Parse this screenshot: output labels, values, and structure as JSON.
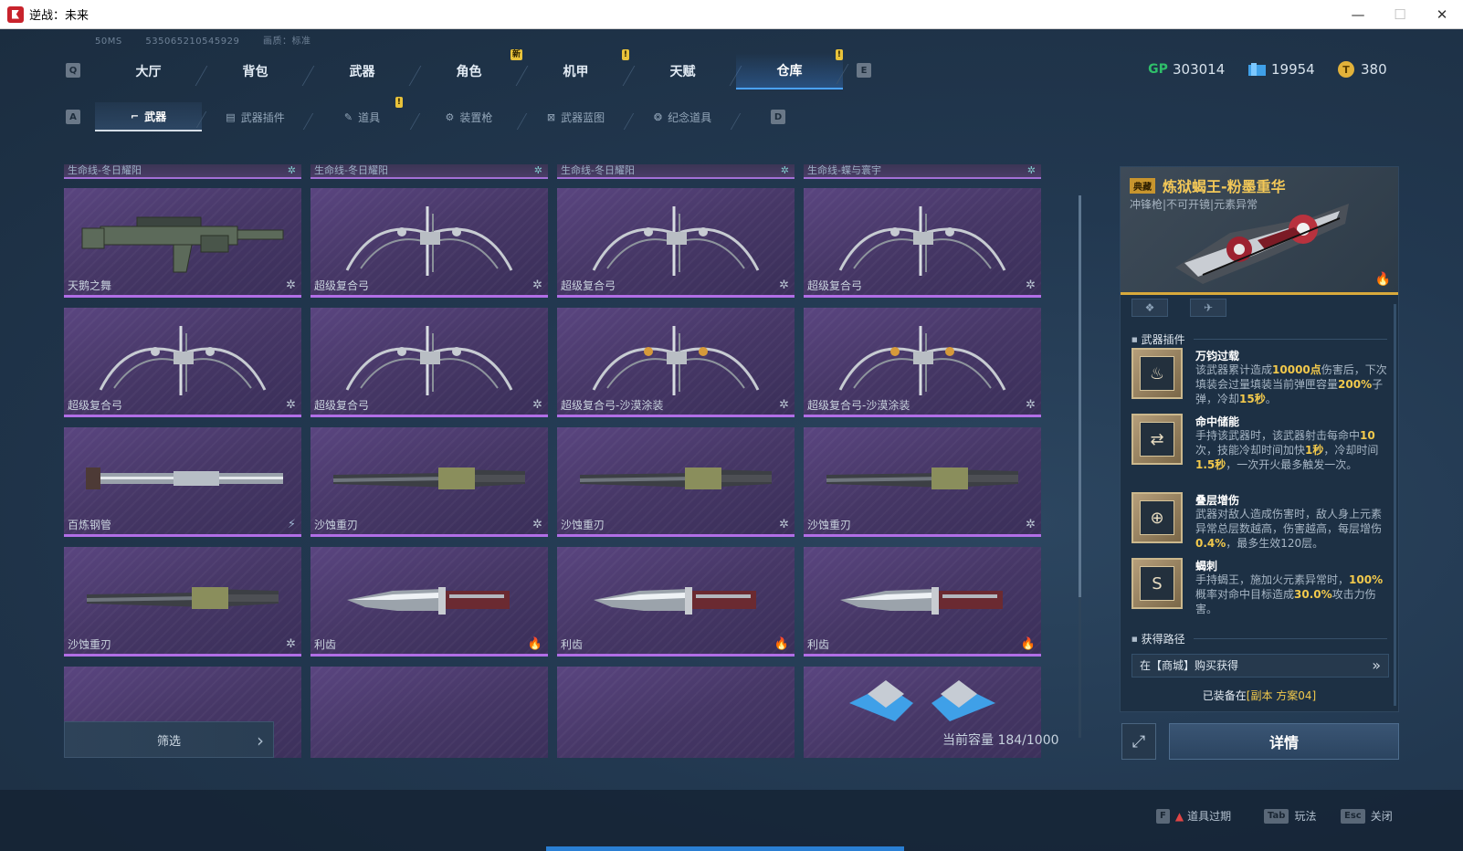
{
  "window": {
    "title": "逆战：未来",
    "controls": [
      "—",
      "☐",
      "✕"
    ]
  },
  "netinfo": {
    "ping": "50MS",
    "id": "535065210545929",
    "quality": "画质：标准"
  },
  "keys": {
    "q": "Q",
    "e": "E",
    "a": "A",
    "d": "D"
  },
  "main_tabs": [
    {
      "label": "大厅",
      "badge": ""
    },
    {
      "label": "背包",
      "badge": ""
    },
    {
      "label": "武器",
      "badge": ""
    },
    {
      "label": "角色",
      "badge": "新"
    },
    {
      "label": "机甲",
      "badge": "!"
    },
    {
      "label": "天赋",
      "badge": ""
    },
    {
      "label": "仓库",
      "badge": "!"
    }
  ],
  "active_main_tab": "仓库",
  "currency": {
    "gp": "303014",
    "ticket": "19954",
    "coin": "380",
    "gp_label": "GP"
  },
  "sub_tabs": [
    {
      "label": "武器",
      "icon": "gun-icon",
      "badge": ""
    },
    {
      "label": "武器插件",
      "icon": "plugin-icon",
      "badge": ""
    },
    {
      "label": "道具",
      "icon": "item-icon",
      "badge": "!"
    },
    {
      "label": "装置枪",
      "icon": "device-gun-icon",
      "badge": ""
    },
    {
      "label": "武器蓝图",
      "icon": "blueprint-icon",
      "badge": ""
    },
    {
      "label": "纪念道具",
      "icon": "souvenir-icon",
      "badge": ""
    }
  ],
  "header_cards": [
    "生命线-冬日耀阳",
    "生命线-冬日耀阳",
    "生命线-冬日耀阳",
    "生命线-蝶与寰宇"
  ],
  "cards": [
    {
      "name": "天鹅之舞",
      "type": "rifle",
      "mark": "✲"
    },
    {
      "name": "超级复合弓",
      "type": "bow",
      "mark": "✲"
    },
    {
      "name": "超级复合弓",
      "type": "bow",
      "mark": "✲"
    },
    {
      "name": "超级复合弓",
      "type": "bow",
      "mark": "✲"
    },
    {
      "name": "超级复合弓",
      "type": "bow",
      "mark": "✲"
    },
    {
      "name": "超级复合弓",
      "type": "bow",
      "mark": "✲"
    },
    {
      "name": "超级复合弓-沙漠涂装",
      "type": "bow-gold",
      "mark": "✲"
    },
    {
      "name": "超级复合弓-沙漠涂装",
      "type": "bow-gold",
      "mark": "✲"
    },
    {
      "name": "百炼钢管",
      "type": "pipe",
      "mark": "⚡"
    },
    {
      "name": "沙蚀重刃",
      "type": "blade",
      "mark": "✲"
    },
    {
      "name": "沙蚀重刃",
      "type": "blade",
      "mark": "✲"
    },
    {
      "name": "沙蚀重刃",
      "type": "blade",
      "mark": "✲"
    },
    {
      "name": "沙蚀重刃",
      "type": "blade",
      "mark": "✲"
    },
    {
      "name": "利齿",
      "type": "knife",
      "mark": "🔥"
    },
    {
      "name": "利齿",
      "type": "knife",
      "mark": "🔥"
    },
    {
      "name": "利齿",
      "type": "knife",
      "mark": "🔥"
    },
    {
      "name": "",
      "type": "partial",
      "mark": ""
    },
    {
      "name": "",
      "type": "partial",
      "mark": ""
    },
    {
      "name": "",
      "type": "partial",
      "mark": ""
    },
    {
      "name": "",
      "type": "partial-wings",
      "mark": ""
    }
  ],
  "filter": {
    "label": "筛选"
  },
  "capacity": "当前容量 184/1000",
  "detail": {
    "rarity": "典藏",
    "name": "炼狱蝎王-粉墨重华",
    "subtitle": "冲锋枪|不可开镜|元素异常",
    "plugins_title": "武器插件",
    "plugins": [
      {
        "name": "万钧过载",
        "icon": "♨",
        "desc_parts": [
          {
            "t": "该武器累计造成",
            "h": false
          },
          {
            "t": "10000点",
            "h": true
          },
          {
            "t": "伤害后，下次填装会过量填装当前弹匣容量",
            "h": false
          },
          {
            "t": "200%",
            "h": true
          },
          {
            "t": "子弹，冷却",
            "h": false
          },
          {
            "t": "15秒",
            "h": true
          },
          {
            "t": "。",
            "h": false
          }
        ]
      },
      {
        "name": "命中储能",
        "icon": "⇄",
        "desc_parts": [
          {
            "t": "手持该武器时，该武器射击每命中",
            "h": false
          },
          {
            "t": "10",
            "h": true
          },
          {
            "t": "次，技能冷却时间加快",
            "h": false
          },
          {
            "t": "1秒",
            "h": true
          },
          {
            "t": "，冷却时间",
            "h": false
          },
          {
            "t": "1.5秒",
            "h": true
          },
          {
            "t": "，一次开火最多触发一次。",
            "h": false
          }
        ]
      },
      {
        "name": "叠层增伤",
        "icon": "⊕",
        "desc_parts": [
          {
            "t": "武器对敌人造成伤害时，敌人身上元素异常总层数越高，伤害越高，每层增伤",
            "h": false
          },
          {
            "t": "0.4%",
            "h": true
          },
          {
            "t": "，最多生效120层。",
            "h": false
          }
        ]
      },
      {
        "name": "蝎刺",
        "icon": "S",
        "desc_parts": [
          {
            "t": "手持蝎王，施加火元素异常时，",
            "h": false
          },
          {
            "t": "100%",
            "h": true
          },
          {
            "t": "概率对命中目标造成",
            "h": false
          },
          {
            "t": "30.0%",
            "h": true
          },
          {
            "t": "攻击力伤害。",
            "h": false
          }
        ]
      }
    ],
    "source_title": "获得路径",
    "source": "在【商城】购买获得",
    "equipped_prefix": "已装备在",
    "equipped_value": "[副本 方案04]"
  },
  "detail_button": "详情",
  "footer": [
    {
      "key": "F",
      "label": "道具过期",
      "warn": true
    },
    {
      "key": "Tab",
      "label": "玩法",
      "warn": false
    },
    {
      "key": "Esc",
      "label": "关闭",
      "warn": false
    }
  ],
  "colors": {
    "accent": "#4aa2ff",
    "highlight": "#f2c94c",
    "card_border": "#b16ee6",
    "rarity_gold": "#d8a93c"
  }
}
